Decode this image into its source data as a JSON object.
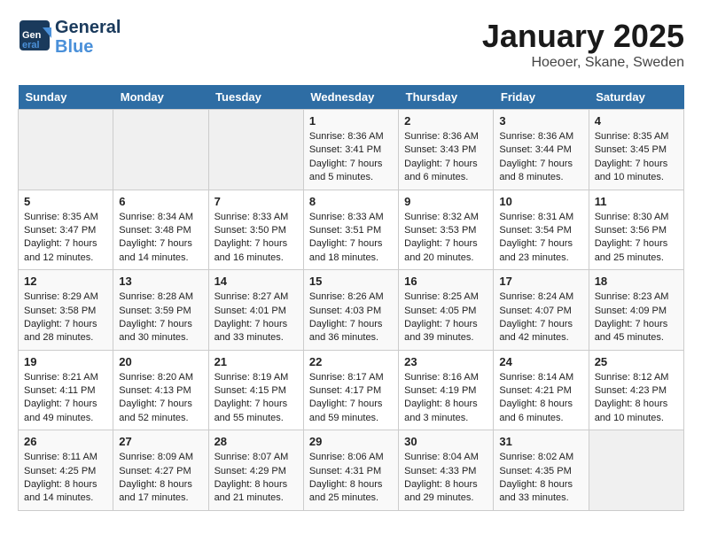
{
  "header": {
    "logo_line1": "General",
    "logo_line2": "Blue",
    "month": "January 2025",
    "location": "Hoeoer, Skane, Sweden"
  },
  "weekdays": [
    "Sunday",
    "Monday",
    "Tuesday",
    "Wednesday",
    "Thursday",
    "Friday",
    "Saturday"
  ],
  "weeks": [
    [
      {
        "day": "",
        "empty": true
      },
      {
        "day": "",
        "empty": true
      },
      {
        "day": "",
        "empty": true
      },
      {
        "day": "1",
        "sunrise": "Sunrise: 8:36 AM",
        "sunset": "Sunset: 3:41 PM",
        "daylight": "Daylight: 7 hours and 5 minutes."
      },
      {
        "day": "2",
        "sunrise": "Sunrise: 8:36 AM",
        "sunset": "Sunset: 3:43 PM",
        "daylight": "Daylight: 7 hours and 6 minutes."
      },
      {
        "day": "3",
        "sunrise": "Sunrise: 8:36 AM",
        "sunset": "Sunset: 3:44 PM",
        "daylight": "Daylight: 7 hours and 8 minutes."
      },
      {
        "day": "4",
        "sunrise": "Sunrise: 8:35 AM",
        "sunset": "Sunset: 3:45 PM",
        "daylight": "Daylight: 7 hours and 10 minutes."
      }
    ],
    [
      {
        "day": "5",
        "sunrise": "Sunrise: 8:35 AM",
        "sunset": "Sunset: 3:47 PM",
        "daylight": "Daylight: 7 hours and 12 minutes."
      },
      {
        "day": "6",
        "sunrise": "Sunrise: 8:34 AM",
        "sunset": "Sunset: 3:48 PM",
        "daylight": "Daylight: 7 hours and 14 minutes."
      },
      {
        "day": "7",
        "sunrise": "Sunrise: 8:33 AM",
        "sunset": "Sunset: 3:50 PM",
        "daylight": "Daylight: 7 hours and 16 minutes."
      },
      {
        "day": "8",
        "sunrise": "Sunrise: 8:33 AM",
        "sunset": "Sunset: 3:51 PM",
        "daylight": "Daylight: 7 hours and 18 minutes."
      },
      {
        "day": "9",
        "sunrise": "Sunrise: 8:32 AM",
        "sunset": "Sunset: 3:53 PM",
        "daylight": "Daylight: 7 hours and 20 minutes."
      },
      {
        "day": "10",
        "sunrise": "Sunrise: 8:31 AM",
        "sunset": "Sunset: 3:54 PM",
        "daylight": "Daylight: 7 hours and 23 minutes."
      },
      {
        "day": "11",
        "sunrise": "Sunrise: 8:30 AM",
        "sunset": "Sunset: 3:56 PM",
        "daylight": "Daylight: 7 hours and 25 minutes."
      }
    ],
    [
      {
        "day": "12",
        "sunrise": "Sunrise: 8:29 AM",
        "sunset": "Sunset: 3:58 PM",
        "daylight": "Daylight: 7 hours and 28 minutes."
      },
      {
        "day": "13",
        "sunrise": "Sunrise: 8:28 AM",
        "sunset": "Sunset: 3:59 PM",
        "daylight": "Daylight: 7 hours and 30 minutes."
      },
      {
        "day": "14",
        "sunrise": "Sunrise: 8:27 AM",
        "sunset": "Sunset: 4:01 PM",
        "daylight": "Daylight: 7 hours and 33 minutes."
      },
      {
        "day": "15",
        "sunrise": "Sunrise: 8:26 AM",
        "sunset": "Sunset: 4:03 PM",
        "daylight": "Daylight: 7 hours and 36 minutes."
      },
      {
        "day": "16",
        "sunrise": "Sunrise: 8:25 AM",
        "sunset": "Sunset: 4:05 PM",
        "daylight": "Daylight: 7 hours and 39 minutes."
      },
      {
        "day": "17",
        "sunrise": "Sunrise: 8:24 AM",
        "sunset": "Sunset: 4:07 PM",
        "daylight": "Daylight: 7 hours and 42 minutes."
      },
      {
        "day": "18",
        "sunrise": "Sunrise: 8:23 AM",
        "sunset": "Sunset: 4:09 PM",
        "daylight": "Daylight: 7 hours and 45 minutes."
      }
    ],
    [
      {
        "day": "19",
        "sunrise": "Sunrise: 8:21 AM",
        "sunset": "Sunset: 4:11 PM",
        "daylight": "Daylight: 7 hours and 49 minutes."
      },
      {
        "day": "20",
        "sunrise": "Sunrise: 8:20 AM",
        "sunset": "Sunset: 4:13 PM",
        "daylight": "Daylight: 7 hours and 52 minutes."
      },
      {
        "day": "21",
        "sunrise": "Sunrise: 8:19 AM",
        "sunset": "Sunset: 4:15 PM",
        "daylight": "Daylight: 7 hours and 55 minutes."
      },
      {
        "day": "22",
        "sunrise": "Sunrise: 8:17 AM",
        "sunset": "Sunset: 4:17 PM",
        "daylight": "Daylight: 7 hours and 59 minutes."
      },
      {
        "day": "23",
        "sunrise": "Sunrise: 8:16 AM",
        "sunset": "Sunset: 4:19 PM",
        "daylight": "Daylight: 8 hours and 3 minutes."
      },
      {
        "day": "24",
        "sunrise": "Sunrise: 8:14 AM",
        "sunset": "Sunset: 4:21 PM",
        "daylight": "Daylight: 8 hours and 6 minutes."
      },
      {
        "day": "25",
        "sunrise": "Sunrise: 8:12 AM",
        "sunset": "Sunset: 4:23 PM",
        "daylight": "Daylight: 8 hours and 10 minutes."
      }
    ],
    [
      {
        "day": "26",
        "sunrise": "Sunrise: 8:11 AM",
        "sunset": "Sunset: 4:25 PM",
        "daylight": "Daylight: 8 hours and 14 minutes."
      },
      {
        "day": "27",
        "sunrise": "Sunrise: 8:09 AM",
        "sunset": "Sunset: 4:27 PM",
        "daylight": "Daylight: 8 hours and 17 minutes."
      },
      {
        "day": "28",
        "sunrise": "Sunrise: 8:07 AM",
        "sunset": "Sunset: 4:29 PM",
        "daylight": "Daylight: 8 hours and 21 minutes."
      },
      {
        "day": "29",
        "sunrise": "Sunrise: 8:06 AM",
        "sunset": "Sunset: 4:31 PM",
        "daylight": "Daylight: 8 hours and 25 minutes."
      },
      {
        "day": "30",
        "sunrise": "Sunrise: 8:04 AM",
        "sunset": "Sunset: 4:33 PM",
        "daylight": "Daylight: 8 hours and 29 minutes."
      },
      {
        "day": "31",
        "sunrise": "Sunrise: 8:02 AM",
        "sunset": "Sunset: 4:35 PM",
        "daylight": "Daylight: 8 hours and 33 minutes."
      },
      {
        "day": "",
        "empty": true
      }
    ]
  ]
}
